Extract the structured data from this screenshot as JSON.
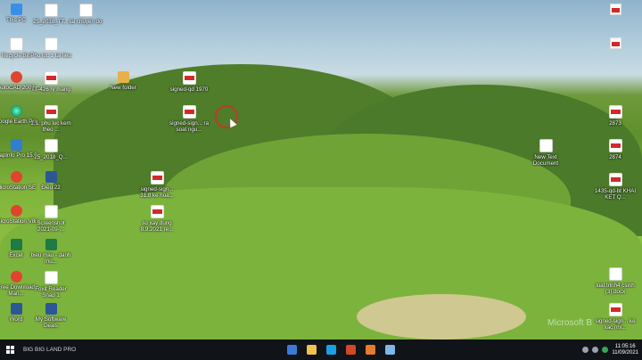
{
  "desktop": {
    "icons": [
      {
        "label": "This PC",
        "glyph": "g-pc",
        "name": "this-pc-icon"
      },
      {
        "label": "25_2018_TT...",
        "glyph": "g-doc",
        "name": "document-icon"
      },
      {
        "label": "tai chuyen do",
        "glyph": "g-doc",
        "name": "document-icon"
      },
      {
        "label": "Recycle Bin",
        "glyph": "g-doc",
        "name": "recycle-bin-icon"
      },
      {
        "label": "Phu luc 1 tai lieu",
        "glyph": "g-doc",
        "name": "document-icon"
      },
      {
        "label": "AutoCAD 2007",
        "glyph": "g-red",
        "name": "autocad-icon"
      },
      {
        "label": "TT-426 ry mang",
        "glyph": "g-pdf",
        "name": "pdf-icon"
      },
      {
        "label": "New folder",
        "glyph": "g-folder",
        "name": "folder-icon"
      },
      {
        "label": "signed-qd 1970",
        "glyph": "g-pdf",
        "name": "pdf-icon"
      },
      {
        "label": "Google Earth Pro",
        "glyph": "g-earth",
        "name": "google-earth-icon"
      },
      {
        "label": "1.1. phu luc kem theo ...",
        "glyph": "g-pdf",
        "name": "pdf-icon"
      },
      {
        "label": "signed-sign... ra soat ngu...",
        "glyph": "g-pdf",
        "name": "pdf-icon"
      },
      {
        "label": "MapInfo Pro 15.0",
        "glyph": "g-app",
        "name": "mapinfo-icon"
      },
      {
        "label": "25_2018_Q...",
        "glyph": "g-doc",
        "name": "document-icon"
      },
      {
        "label": "MicroStation SE",
        "glyph": "g-red",
        "name": "microstation-icon"
      },
      {
        "label": "Điều 22",
        "glyph": "g-word",
        "name": "word-doc-icon"
      },
      {
        "label": "signed-sign... 31.8 ke hoa...",
        "glyph": "g-pdf",
        "name": "pdf-icon"
      },
      {
        "label": "MicroStation V8i",
        "glyph": "g-red",
        "name": "microstation-icon"
      },
      {
        "label": "Screenshot 2021-09-...",
        "glyph": "g-doc",
        "name": "screenshot-icon"
      },
      {
        "label": "so xay dung 8.9.2021 re...",
        "glyph": "g-pdf",
        "name": "pdf-icon"
      },
      {
        "label": "Excel",
        "glyph": "g-excel",
        "name": "excel-icon"
      },
      {
        "label": "bieu mau - danh mu...",
        "glyph": "g-excel",
        "name": "excel-doc-icon"
      },
      {
        "label": "Free Download Man...",
        "glyph": "g-red",
        "name": "app-icon"
      },
      {
        "label": "Foxit Reader Snap 1",
        "glyph": "g-doc",
        "name": "app-icon"
      },
      {
        "label": "Word",
        "glyph": "g-word",
        "name": "word-icon"
      },
      {
        "label": "My Software Deals",
        "glyph": "g-word",
        "name": "word-doc-icon"
      },
      {
        "label": "2873",
        "glyph": "g-pdf",
        "name": "pdf-icon"
      },
      {
        "label": "New Text Document",
        "glyph": "g-doc",
        "name": "text-doc-icon"
      },
      {
        "label": "2874",
        "glyph": "g-pdf",
        "name": "pdf-icon"
      },
      {
        "label": "1435-qd-bt KHAI KET Q...",
        "glyph": "g-pdf",
        "name": "pdf-icon"
      },
      {
        "label": "luat trinh4 csinh (3).docx",
        "glyph": "g-doc",
        "name": "document-icon"
      },
      {
        "label": "signed-sign... ke xac nhi...",
        "glyph": "g-pdf",
        "name": "pdf-icon"
      }
    ],
    "watermark": "Microsoft B"
  },
  "taskbar": {
    "search_label": "BIG BIG LAND PRO",
    "apps": [
      {
        "name": "calculator-icon",
        "color": "#3a7bd5"
      },
      {
        "name": "file-explorer-icon",
        "color": "#f2c14e"
      },
      {
        "name": "edge-icon",
        "color": "#1ba1e2"
      },
      {
        "name": "powerpoint-icon",
        "color": "#d24726"
      },
      {
        "name": "app-icon",
        "color": "#e57b2f"
      },
      {
        "name": "notepad-icon",
        "color": "#7fb6e6"
      }
    ],
    "clock_time": "11:05:16",
    "clock_date": "11/09/2021"
  }
}
